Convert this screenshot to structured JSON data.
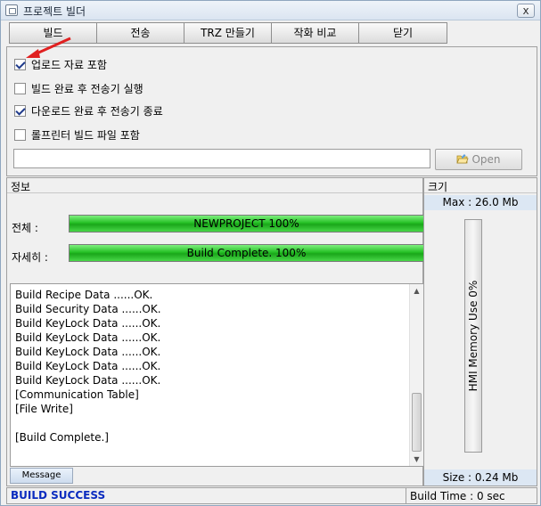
{
  "window": {
    "title": "프로젝트 빌더",
    "close_glyph": "x"
  },
  "tabs": [
    {
      "label": "빌드"
    },
    {
      "label": "전송"
    },
    {
      "label": "TRZ 만들기"
    },
    {
      "label": "작화 비교"
    },
    {
      "label": "닫기"
    }
  ],
  "options": [
    {
      "label": "업로드 자료 포함",
      "checked": true
    },
    {
      "label": "빌드 완료 후 전송기 실행",
      "checked": false
    },
    {
      "label": "다운로드 완료 후 전송기 종료",
      "checked": true
    },
    {
      "label": "롤프린터 빌드 파일 포함",
      "checked": false
    }
  ],
  "path_input": {
    "value": ""
  },
  "open_button": {
    "label": "Open",
    "icon": "folder-open-icon"
  },
  "info": {
    "title": "정보",
    "total_label": "전체 :",
    "total_text": "NEWPROJECT  100%",
    "total_progress": 100,
    "detail_label": "자세히 :",
    "detail_text": "Build Complete.  100%",
    "detail_progress": 100
  },
  "log_lines": [
    "Build Recipe Data ......OK.",
    "Build Security Data ......OK.",
    "Build KeyLock Data ......OK.",
    "Build KeyLock Data ......OK.",
    "Build KeyLock Data ......OK.",
    "Build KeyLock Data ......OK.",
    "Build KeyLock Data ......OK.",
    "[Communication Table]",
    "[File Write]",
    "",
    "[Build Complete.]"
  ],
  "message_tab": "Message",
  "size": {
    "title": "크기",
    "max": "Max : 26.0 Mb",
    "current": "Size : 0.24 Mb",
    "memory_label": "HMI Memory Use  0%",
    "memory_use": 0
  },
  "status": {
    "result": "BUILD SUCCESS",
    "build_time": "Build Time : 0 sec"
  },
  "colors": {
    "progress": "#25c025",
    "status_text": "#0a2bbf",
    "annotation_arrow": "#e02020"
  }
}
